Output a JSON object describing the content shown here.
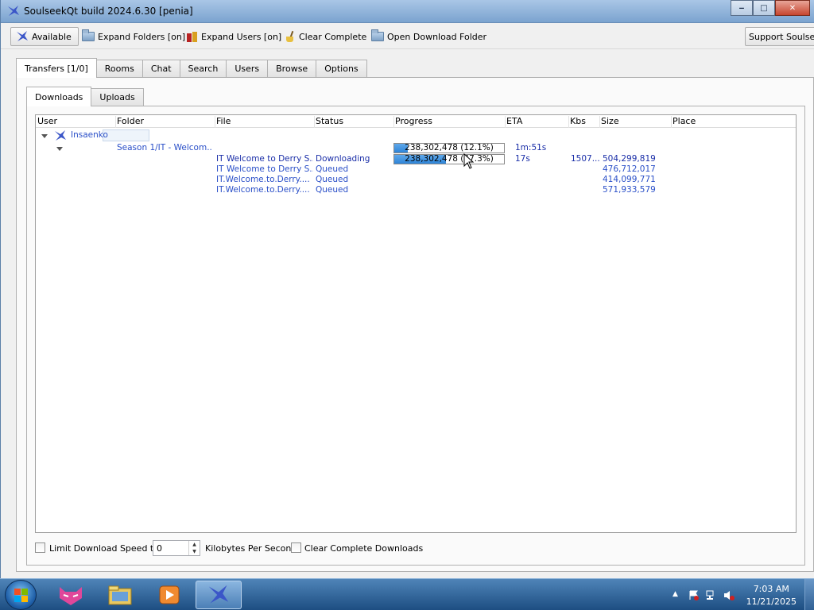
{
  "window": {
    "title": "SoulseekQt build 2024.6.30 [penia]",
    "controls": {
      "minimize": "‒",
      "maximize": "□",
      "close": "✕"
    }
  },
  "toolbar": {
    "status_label": "Available",
    "expand_folders_label": "Expand Folders [on]",
    "expand_users_label": "Expand Users [on]",
    "clear_complete_label": "Clear Complete",
    "open_download_folder_label": "Open Download Folder",
    "support_label": "Support Soulseek"
  },
  "main_tabs": [
    {
      "label": "Transfers [1/0]",
      "active": true
    },
    {
      "label": "Rooms"
    },
    {
      "label": "Chat"
    },
    {
      "label": "Search"
    },
    {
      "label": "Users"
    },
    {
      "label": "Browse"
    },
    {
      "label": "Options"
    }
  ],
  "sub_tabs": [
    {
      "label": "Downloads",
      "active": true
    },
    {
      "label": "Uploads"
    }
  ],
  "columns": [
    "User",
    "Folder",
    "File",
    "Status",
    "Progress",
    "ETA",
    "Kbs",
    "Size",
    "Place"
  ],
  "transfers": {
    "user": "Insaenko",
    "folder": {
      "name": "Season 1/IT - Welcom...",
      "progress_text": "238,302,478 (12.1%)",
      "progress_fraction": 0.121,
      "eta": "1m:51s"
    },
    "files": [
      {
        "file": "IT Welcome to Derry S...",
        "status": "Downloading",
        "progress_text": "238,302,478 (47.3%)",
        "progress_fraction": 0.473,
        "eta": "17s",
        "kbs": "1507...",
        "size": "504,299,819"
      },
      {
        "file": "IT Welcome to Derry S...",
        "status": "Queued",
        "progress_text": "",
        "eta": "",
        "kbs": "",
        "size": "476,712,017"
      },
      {
        "file": "IT.Welcome.to.Derry....",
        "status": "Queued",
        "progress_text": "",
        "eta": "",
        "kbs": "",
        "size": "414,099,771"
      },
      {
        "file": "IT.Welcome.to.Derry....",
        "status": "Queued",
        "progress_text": "",
        "eta": "",
        "kbs": "",
        "size": "571,933,579"
      }
    ]
  },
  "bottom": {
    "limit_speed_label": "Limit Download Speed to",
    "limit_speed_checked": false,
    "speed_value": "0",
    "speed_unit_label": "Kilobytes Per Second",
    "clear_complete_downloads_label": "Clear Complete Downloads",
    "clear_complete_checked": false
  },
  "taskbar": {
    "time": "7:03 AM",
    "date": "11/21/2025",
    "items": [
      "start-button",
      "app-firefox-like",
      "windows-explorer",
      "media-player",
      "soulseekqt"
    ]
  },
  "colors": {
    "link_blue": "#2a4fc8",
    "progress_fill": "#2e84d8",
    "taskbar": "#1d4e82",
    "title_bar": "#7ba3cf"
  }
}
